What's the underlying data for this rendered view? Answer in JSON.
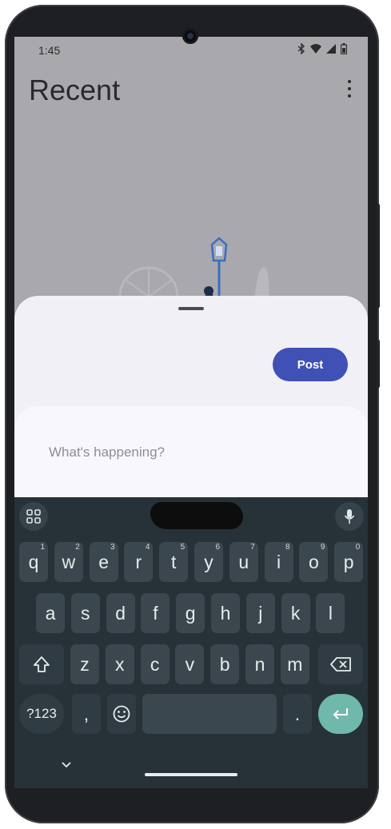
{
  "status_bar": {
    "time": "1:45"
  },
  "header": {
    "title": "Recent"
  },
  "sheet": {
    "post_label": "Post",
    "compose_placeholder": "What's happening?"
  },
  "keyboard": {
    "row1": [
      {
        "label": "q",
        "hint": "1"
      },
      {
        "label": "w",
        "hint": "2"
      },
      {
        "label": "e",
        "hint": "3"
      },
      {
        "label": "r",
        "hint": "4"
      },
      {
        "label": "t",
        "hint": "5"
      },
      {
        "label": "y",
        "hint": "6"
      },
      {
        "label": "u",
        "hint": "7"
      },
      {
        "label": "i",
        "hint": "8"
      },
      {
        "label": "o",
        "hint": "9"
      },
      {
        "label": "p",
        "hint": "0"
      }
    ],
    "row2": [
      "a",
      "s",
      "d",
      "f",
      "g",
      "h",
      "j",
      "k",
      "l"
    ],
    "row3": [
      "z",
      "x",
      "c",
      "v",
      "b",
      "n",
      "m"
    ],
    "symbols_label": "?123",
    "comma_label": ",",
    "period_label": "."
  },
  "colors": {
    "accent": "#3f51b5",
    "keyboard_bg": "#263238",
    "key_bg": "#3b474e",
    "enter_key": "#6fb8ab"
  },
  "icons": [
    "bluetooth-icon",
    "wifi-icon",
    "signal-icon",
    "battery-icon",
    "more-vert-icon",
    "apps-grid-icon",
    "mic-icon",
    "shift-icon",
    "backspace-icon",
    "emoji-icon",
    "enter-icon",
    "chevron-down-icon"
  ]
}
